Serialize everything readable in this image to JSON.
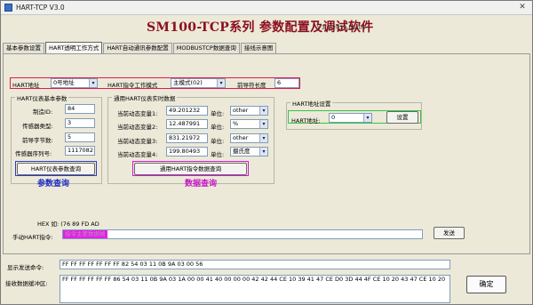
{
  "window": {
    "title": "HART-TCP V3.0",
    "close_glyph": "✕"
  },
  "heading": "SM100-TCP系列 参数配置及调试软件",
  "version": "V3.0 2019-06-06",
  "tabs": [
    {
      "label": "基本参数设置",
      "active": false
    },
    {
      "label": "HART透明工作方式",
      "active": true
    },
    {
      "label": "HART自动通讯参数配置",
      "active": false
    },
    {
      "label": "MODBUSTCP数据查询",
      "active": false
    },
    {
      "label": "接线示意图",
      "active": false
    }
  ],
  "hart_address": {
    "label": "HART地址",
    "value": "0号地址"
  },
  "work_mode": {
    "label": "HART指令工作模式",
    "value": "主模式(02)"
  },
  "preamble": {
    "label": "前导符长度",
    "value": "6"
  },
  "basic_group": {
    "title": "HART仪表基本参数",
    "fields": [
      {
        "label": "制造ID:",
        "value": "84"
      },
      {
        "label": "传感器类型:",
        "value": "3"
      },
      {
        "label": "前导字节数:",
        "value": "5"
      },
      {
        "label": "传感器序列号:",
        "value": "1117082"
      }
    ],
    "query_button": "HART仪表参数查询",
    "annotation": "参数查询"
  },
  "realtime_group": {
    "title": "通用HART仪表实时数据",
    "rows": [
      {
        "label": "当前动态变量1:",
        "value": "49.201232",
        "unit_label": "单位:",
        "unit": "other"
      },
      {
        "label": "当前动态变量2:",
        "value": "12.487991",
        "unit_label": "单位:",
        "unit": "%"
      },
      {
        "label": "当前动态变量3:",
        "value": "831.21972",
        "unit_label": "单位:",
        "unit": "other"
      },
      {
        "label": "当前动态变量4:",
        "value": "199.80493",
        "unit_label": "单位:",
        "unit": "摄氏度"
      }
    ],
    "query_button": "通用HART指令数据查询",
    "annotation": "数据查询"
  },
  "addr_set_group": {
    "title": "HART地址设置",
    "addr_label": "HART地址:",
    "addr_value": "0",
    "set_button": "设置"
  },
  "manual": {
    "hex_hint": "HEX 如: (76 89 FD AD",
    "label": "手动HART指令:",
    "placeholder_text": "指令主要数据帧",
    "send_button": "发送"
  },
  "display_send": {
    "label": "显示发送命令:",
    "value": "FF FF FF FF FF FF FF 82 54 03 11 0B 9A 03 00 56"
  },
  "recv_buffer": {
    "label": "接收数据缓冲区:",
    "value": "FF FF FF FF FF FF 86 54 03 11 0B 9A 03 1A 00 00 41 40 00 00 00 42 42 44 CE 10 39 41 47 CE D0 3D 44 4F CE 10 20 43 47 CE 10 20"
  },
  "confirm_button": "确定",
  "icons": {
    "arrow": "▾"
  }
}
